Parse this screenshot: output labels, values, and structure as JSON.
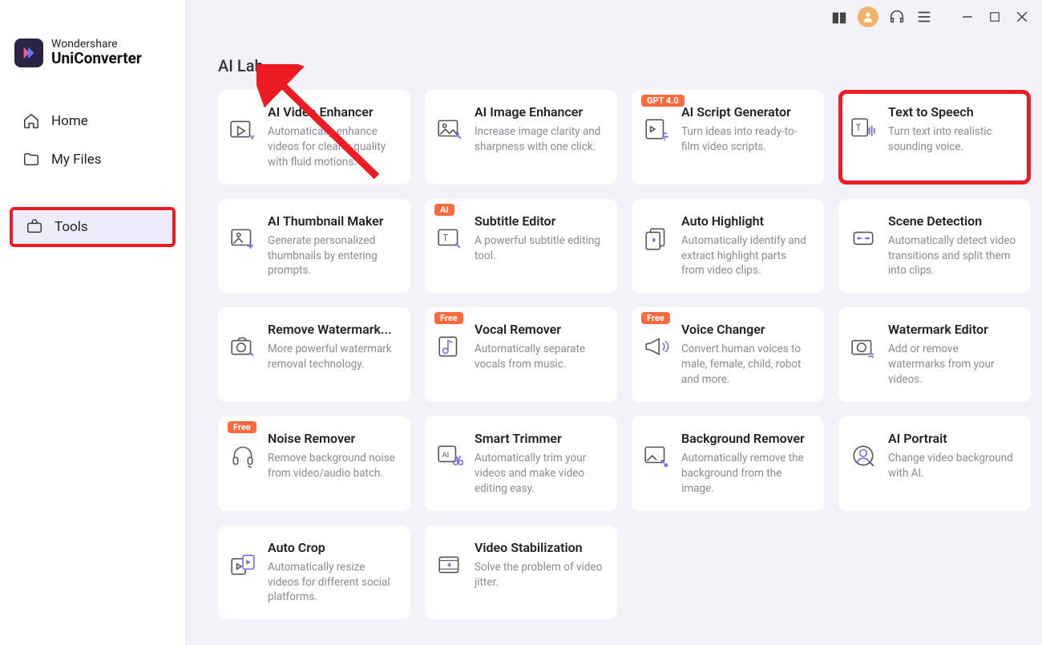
{
  "brand": {
    "company": "Wondershare",
    "product": "UniConverter"
  },
  "sidebar": {
    "items": [
      {
        "label": "Home",
        "name": "sidebar-item-home",
        "active": false
      },
      {
        "label": "My Files",
        "name": "sidebar-item-my-files",
        "active": false
      },
      {
        "label": "Tools",
        "name": "sidebar-item-tools",
        "active": true,
        "highlighted": true
      }
    ]
  },
  "section": {
    "title": "AI Lab"
  },
  "cards": [
    {
      "title": "AI Video Enhancer",
      "desc": "Automatically enhance videos for clearer quality with fluid motions.",
      "badge": null,
      "name": "card-ai-video-enhancer",
      "icon": "video-sparkle"
    },
    {
      "title": "AI Image Enhancer",
      "desc": "Increase image clarity and sharpness with one click.",
      "badge": null,
      "name": "card-ai-image-enhancer",
      "icon": "image-edit"
    },
    {
      "title": "AI Script Generator",
      "desc": "Turn ideas into ready-to-film video scripts.",
      "badge": "GPT 4.0",
      "name": "card-ai-script-generator",
      "icon": "script-text"
    },
    {
      "title": "Text to Speech",
      "desc": "Turn text into realistic sounding voice.",
      "badge": null,
      "name": "card-text-to-speech",
      "icon": "tts",
      "highlight": true
    },
    {
      "title": "AI Thumbnail Maker",
      "desc": "Generate personalized thumbnails by entering prompts.",
      "badge": null,
      "name": "card-ai-thumbnail-maker",
      "icon": "image-plus"
    },
    {
      "title": "Subtitle Editor",
      "desc": "A powerful subtitle editing tool.",
      "badge": "AI",
      "name": "card-subtitle-editor",
      "icon": "subtitle-edit"
    },
    {
      "title": "Auto Highlight",
      "desc": "Automatically identify and extract highlight parts from video clips.",
      "badge": null,
      "name": "card-auto-highlight",
      "icon": "cards-sparkle"
    },
    {
      "title": "Scene Detection",
      "desc": "Automatically detect video transitions and split them into clips.",
      "badge": null,
      "name": "card-scene-detection",
      "icon": "split"
    },
    {
      "title": "Remove Watermark...",
      "desc": "More powerful watermark removal technology.",
      "badge": null,
      "name": "card-remove-watermark",
      "icon": "camera-remove"
    },
    {
      "title": "Vocal Remover",
      "desc": "Automatically separate vocals from music.",
      "badge": "Free",
      "name": "card-vocal-remover",
      "icon": "music-note"
    },
    {
      "title": "Voice Changer",
      "desc": "Convert human voices to male, female, child, robot and more.",
      "badge": "Free",
      "name": "card-voice-changer",
      "icon": "megaphone"
    },
    {
      "title": "Watermark Editor",
      "desc": "Add or remove watermarks from your videos.",
      "badge": null,
      "name": "card-watermark-editor",
      "icon": "camera-wave"
    },
    {
      "title": "Noise Remover",
      "desc": "Remove background noise from video/audio batch.",
      "badge": "Free",
      "name": "card-noise-remover",
      "icon": "headphones"
    },
    {
      "title": "Smart Trimmer",
      "desc": "Automatically trim your videos and make video editing easy.",
      "badge": null,
      "name": "card-smart-trimmer",
      "icon": "ai-scissors"
    },
    {
      "title": "Background Remover",
      "desc": "Automatically remove the background from the image.",
      "badge": null,
      "name": "card-background-remover",
      "icon": "image-checker"
    },
    {
      "title": "AI Portrait",
      "desc": "Change video background with AI.",
      "badge": null,
      "name": "card-ai-portrait",
      "icon": "portrait-scan"
    },
    {
      "title": "Auto Crop",
      "desc": "Automatically resize videos for different social platforms.",
      "badge": null,
      "name": "card-auto-crop",
      "icon": "crop-play"
    },
    {
      "title": "Video Stabilization",
      "desc": "Solve the problem of video jitter.",
      "badge": null,
      "name": "card-video-stabilization",
      "icon": "stabilize"
    }
  ]
}
